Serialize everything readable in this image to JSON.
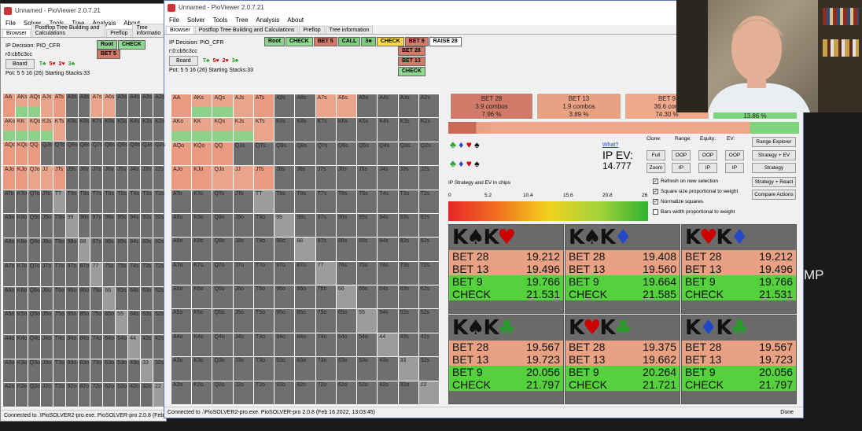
{
  "win1": {
    "title": "Unnamed - PioViewer 2.0.7.21",
    "menu": [
      "File",
      "Solver",
      "Tools",
      "Tree",
      "Analysis",
      "About"
    ],
    "tabs": [
      "Browser",
      "Postflop Tree Building and Calculations",
      "Preflop",
      "Tree informatio"
    ],
    "decision": "IP Decision:  PIO_CFR",
    "board_str": "r0:cb5c3cc",
    "board_btn": "Board",
    "suits": [
      "T♣",
      "5♥",
      "2♥",
      "3♣"
    ],
    "pot": "Pot: 5 5 16 (26) Starting Stacks:33",
    "chips": [
      "Root",
      "CHECK",
      "BET 5"
    ],
    "status": "Connected to .\\PioSOLVER2-pro.exe. PioSOLVER-pro 2.0.8 (Feb 16 202"
  },
  "win2": {
    "title": "Unnamed - PioViewer 2.0.7.21",
    "menu": [
      "File",
      "Solver",
      "Tools",
      "Tree",
      "Analysis",
      "About"
    ],
    "tabs": [
      "Browser",
      "Postflop Tree Building and Calculations",
      "Preflop",
      "Tree information"
    ],
    "decision": "IP Decision:  PIO_CFR",
    "board_str": "r:0:cb5c3cc",
    "board_btn": "Board",
    "suits": [
      "T♣",
      "5♥",
      "2♥",
      "3♣"
    ],
    "pot": "Pot: 5 5 16 (26) Starting Stacks:33",
    "chips": [
      "Root",
      "CHECK",
      "BET 5",
      "CALL",
      "3♣",
      "CHECK",
      "BET 9",
      "RAISE 28"
    ],
    "sub_chips": [
      "BET 28",
      "BET 13",
      "CHECK"
    ],
    "status": "Connected to .\\PioSOLVER2-pro.exe. PioSOLVER-pro 2.0.8 (Feb 16 2022, 13:03:45)",
    "done": "Done"
  },
  "ranks": [
    "A",
    "K",
    "Q",
    "J",
    "T",
    "9",
    "8",
    "7",
    "6",
    "5",
    "4",
    "3",
    "2"
  ],
  "panel": {
    "boxes": [
      {
        "label": "BET 28",
        "combos": "3.9 combos",
        "pct": "7.96 %"
      },
      {
        "label": "BET 13",
        "combos": "1.9 combos",
        "pct": "3.89 %"
      },
      {
        "label": "BET 9",
        "combos": "36.6 com",
        "pct": "74.30 %"
      },
      {
        "label": "",
        "combos": "",
        "pct": "13.86 %"
      }
    ],
    "what": "What?",
    "ev_label": "IP EV:",
    "ev_value": "14.777",
    "clone": "Clone:",
    "range": "Range:",
    "equity": "Equity:",
    "ev": "EV:",
    "btns": {
      "full": "Full",
      "zoom": "Zoom",
      "oop1": "OOP",
      "ip1": "IP",
      "oop2": "OOP",
      "ip2": "IP",
      "oop3": "OOP",
      "ip3": "IP",
      "range_explorer": "Range Explorer",
      "strategy_ev": "Strategy + EV",
      "strategy": "Strategy",
      "strategy_react": "Strategy + React",
      "compare": "Compare Actions"
    },
    "checks": [
      "Refresh on new selection",
      "Square size proportional to weight",
      "Normalize squares",
      "Bars width proportional to weight"
    ],
    "scale_title": "IP Strategy and EV in chips",
    "scale_ticks": [
      "0",
      "5.2",
      "10.4",
      "15.6",
      "20.8",
      "26"
    ]
  },
  "combos": [
    {
      "hand": "K♠K♥",
      "rows": [
        [
          "BET 28",
          "19.212"
        ],
        [
          "BET 13",
          "19.496"
        ],
        [
          "BET 9",
          "19.766"
        ],
        [
          "CHECK",
          "21.531"
        ]
      ]
    },
    {
      "hand": "K♠K♦",
      "rows": [
        [
          "BET 28",
          "19.408"
        ],
        [
          "BET 13",
          "19.560"
        ],
        [
          "BET 9",
          "19.664"
        ],
        [
          "CHECK",
          "21.585"
        ]
      ]
    },
    {
      "hand": "K♥K♦",
      "rows": [
        [
          "BET 28",
          "19.212"
        ],
        [
          "BET 13",
          "19.496"
        ],
        [
          "BET 9",
          "19.766"
        ],
        [
          "CHECK",
          "21.531"
        ]
      ]
    },
    {
      "hand": "K♠K♣",
      "rows": [
        [
          "BET 28",
          "19.567"
        ],
        [
          "BET 13",
          "19.723"
        ],
        [
          "BET 9",
          "20.056"
        ],
        [
          "CHECK",
          "21.797"
        ]
      ]
    },
    {
      "hand": "K♥K♣",
      "rows": [
        [
          "BET 28",
          "19.375"
        ],
        [
          "BET 13",
          "19.662"
        ],
        [
          "BET 9",
          "20.264"
        ],
        [
          "CHECK",
          "21.721"
        ]
      ]
    },
    {
      "hand": "K♦K♣",
      "rows": [
        [
          "BET 28",
          "19.567"
        ],
        [
          "BET 13",
          "19.723"
        ],
        [
          "BET 9",
          "20.056"
        ],
        [
          "CHECK",
          "21.797"
        ]
      ]
    }
  ],
  "side_text": "MP",
  "colors": {
    "bet": "#e9a184",
    "check": "#54d13c",
    "cell": "#6f6f6f"
  }
}
